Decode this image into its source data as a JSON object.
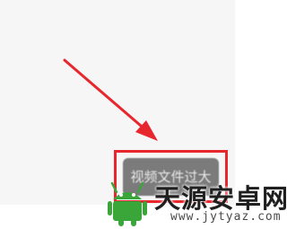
{
  "toast": {
    "label": "视频文件过大"
  },
  "watermark": {
    "title": "天源安卓网",
    "url": "www.jytyaz.com"
  },
  "colors": {
    "highlight": "#e8262d",
    "arrow": "#e8262d",
    "button": "#7b7b7b",
    "robot": "#3aa63a"
  },
  "icons": {
    "pointer": "arrow-icon",
    "logo": "android-robot-icon"
  }
}
